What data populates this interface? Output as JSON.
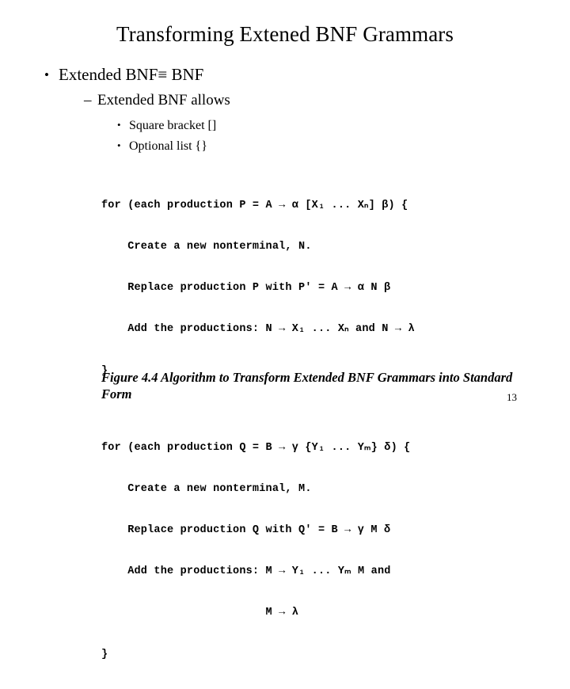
{
  "slide": {
    "title": "Transforming Extened BNF Grammars",
    "page_number": "13",
    "bullets": {
      "level1": {
        "marker": "•",
        "text": "Extended BNF≡ BNF"
      },
      "level2": {
        "marker": "–",
        "text": "Extended BNF allows"
      },
      "level3": [
        {
          "marker": "•",
          "text": "Square bracket []"
        },
        {
          "marker": "•",
          "text": "Optional list {}"
        }
      ]
    },
    "figure": {
      "block1": [
        "for (each production P = A → α [X₁ ... Xₙ] β) {",
        "    Create a new nonterminal, N.",
        "    Replace production P with P′ = A → α N β",
        "    Add the productions: N → X₁ ... Xₙ and N → λ",
        "}"
      ],
      "block2": [
        "for (each production Q = B → γ {Y₁ ... Yₘ} δ) {",
        "    Create a new nonterminal, M.",
        "    Replace production Q with Q′ = B → γ M δ",
        "    Add the productions: M → Y₁ ... Yₘ M and",
        "                         M → λ",
        "}"
      ],
      "caption": "Figure 4.4  Algorithm to Transform Extended BNF Grammars into Standard Form"
    }
  }
}
